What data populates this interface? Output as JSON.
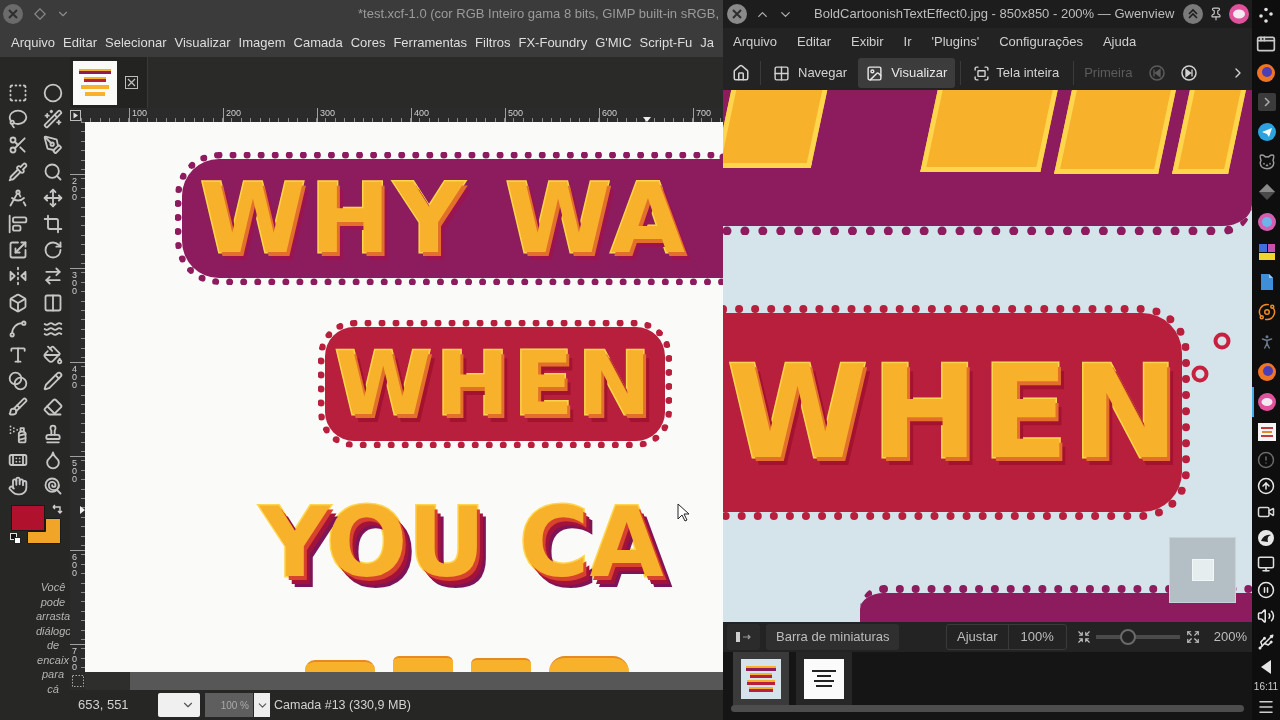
{
  "gimp": {
    "title": "*test.xcf-1.0 (cor RGB Inteiro gama 8 bits, GIMP built-in sRGB,",
    "menu": [
      "Arquivo",
      "Editar",
      "Selecionar",
      "Visualizar",
      "Imagem",
      "Camada",
      "Cores",
      "Ferramentas",
      "Filtros",
      "FX-Foundry",
      "G'MIC",
      "Script-Fu",
      "Ja"
    ],
    "color_swatches": [
      {
        "kind": "foreground",
        "color": "#b0122e"
      },
      {
        "kind": "background",
        "color": "#f0a428"
      }
    ],
    "dock_hint": [
      "Você",
      "pode",
      "arrasta",
      "diálogo",
      "de",
      "encaix",
      "para",
      "cá"
    ],
    "rulers": {
      "horizontal": [
        "100",
        "200",
        "300",
        "400",
        "500",
        "600",
        "700"
      ],
      "vertical": [
        "200",
        "300",
        "400",
        "500",
        "600",
        "700"
      ]
    },
    "canvas": {
      "lines": [
        {
          "kind": "banner",
          "text": "WHY WA"
        },
        {
          "kind": "badge",
          "text": "WHEN"
        },
        {
          "kind": "plain",
          "text": "YOU CA"
        }
      ]
    },
    "status_bar": {
      "coordinates": "653, 551",
      "zoom": "100 %",
      "layer": "Camada #13 (330,9 MB)"
    }
  },
  "gwenview": {
    "title": "BoldCartoonishTextEffect0.jpg - 850x850 - 200% — Gwenview",
    "menu": [
      "Arquivo",
      "Editar",
      "Exibir",
      "Ir",
      "'Plugins'",
      "Configurações",
      "Ajuda"
    ],
    "modes": [
      {
        "kind": "browse",
        "label": "Navegar",
        "selected": false
      },
      {
        "kind": "view",
        "label": "Visualizar",
        "selected": true
      }
    ],
    "actions": [
      {
        "kind": "fullscreen",
        "label": "Tela inteira",
        "disabled": false
      },
      {
        "kind": "first",
        "label": "Primeira",
        "disabled": true
      },
      {
        "kind": "previous",
        "disabled": true
      },
      {
        "kind": "next",
        "disabled": false
      }
    ],
    "image": {
      "text": "WHEN"
    },
    "bottom_bar": {
      "thumbnail_bar": "Barra de miniaturas",
      "fit": "Ajustar",
      "actual_size": "100%",
      "zoom": {
        "level": 0.38,
        "reading": "200%"
      }
    },
    "thumbnails": [
      {
        "selected": true
      },
      {
        "selected": false
      }
    ]
  },
  "taskbar": {
    "launchers": [
      {
        "selected": false
      },
      {
        "selected": false
      },
      {
        "selected": false
      },
      {
        "selected": false
      },
      {
        "selected": false
      },
      {
        "selected": false
      },
      {
        "selected": false
      },
      {
        "selected": false
      },
      {
        "selected": false
      },
      {
        "selected": false
      },
      {
        "selected": true
      },
      {
        "selected": false
      }
    ],
    "clock": "16:11"
  }
}
